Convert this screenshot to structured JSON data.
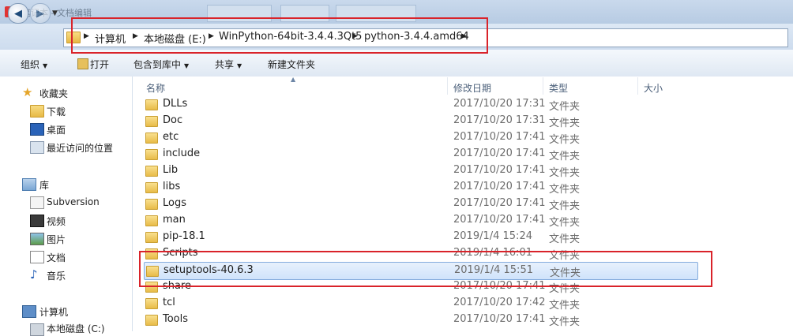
{
  "window": {
    "title": "笔记本 - 文档编辑"
  },
  "address": {
    "crumbs": [
      "计算机",
      "本地磁盘 (E:)",
      "WinPython-64bit-3.4.4.3Qt5",
      "python-3.4.4.amd64"
    ]
  },
  "toolbar": {
    "organize": "组织",
    "open": "打开",
    "include_library": "包含到库中",
    "share": "共享",
    "new_folder": "新建文件夹"
  },
  "columns": {
    "name": "名称",
    "modified": "修改日期",
    "type": "类型",
    "size": "大小"
  },
  "sidebar": {
    "favorites": {
      "title": "收藏夹",
      "items": [
        "下载",
        "桌面",
        "最近访问的位置"
      ]
    },
    "libraries": {
      "title": "库",
      "items": [
        "Subversion",
        "视频",
        "图片",
        "文档",
        "音乐"
      ]
    },
    "computer": {
      "title": "计算机",
      "items": [
        "本地磁盘 (C:)"
      ]
    }
  },
  "files": [
    {
      "name": "DLLs",
      "modified": "2017/10/20 17:31",
      "type": "文件夹"
    },
    {
      "name": "Doc",
      "modified": "2017/10/20 17:31",
      "type": "文件夹"
    },
    {
      "name": "etc",
      "modified": "2017/10/20 17:41",
      "type": "文件夹"
    },
    {
      "name": "include",
      "modified": "2017/10/20 17:41",
      "type": "文件夹"
    },
    {
      "name": "Lib",
      "modified": "2017/10/20 17:41",
      "type": "文件夹"
    },
    {
      "name": "libs",
      "modified": "2017/10/20 17:41",
      "type": "文件夹"
    },
    {
      "name": "Logs",
      "modified": "2017/10/20 17:41",
      "type": "文件夹"
    },
    {
      "name": "man",
      "modified": "2017/10/20 17:41",
      "type": "文件夹"
    },
    {
      "name": "pip-18.1",
      "modified": "2019/1/4 15:24",
      "type": "文件夹"
    },
    {
      "name": "Scripts",
      "modified": "2019/1/4 16:01",
      "type": "文件夹"
    },
    {
      "name": "setuptools-40.6.3",
      "modified": "2019/1/4 15:51",
      "type": "文件夹",
      "selected": true
    },
    {
      "name": "share",
      "modified": "2017/10/20 17:41",
      "type": "文件夹"
    },
    {
      "name": "tcl",
      "modified": "2017/10/20 17:42",
      "type": "文件夹"
    },
    {
      "name": "Tools",
      "modified": "2017/10/20 17:41",
      "type": "文件夹"
    }
  ],
  "colors": {
    "highlight_red": "#d9232a",
    "selection": "#cfe3fb"
  }
}
